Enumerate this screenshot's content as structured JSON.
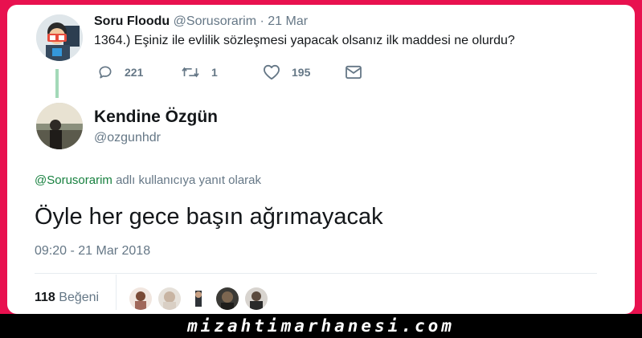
{
  "quoted_tweet": {
    "author_name": "Soru Floodu",
    "author_handle": "@Sorusorarim",
    "separator": "·",
    "date": "21 Mar",
    "text": "1364.) Eşiniz ile evlilik sözleşmesi yapacak olsanız ilk maddesi ne olurdu?",
    "replies": "221",
    "retweets": "1",
    "likes": "195"
  },
  "main_tweet": {
    "author_name": "Kendine Özgün",
    "author_handle": "@ozgunhdr",
    "reply_to_handle": "@Sorusorarim",
    "reply_to_suffix": "adlı kullanıcıya yanıt olarak",
    "text": "Öyle her gece başın ağrımayacak",
    "timestamp": "09:20 - 21 Mar 2018",
    "like_count": "118",
    "like_label": "Beğeni"
  },
  "watermark": "mizahtimarhanesi.com",
  "colors": {
    "frame": "#e8114f",
    "reply_link": "#17803f",
    "thread_line": "#a3d9b8",
    "muted": "#657786"
  },
  "icons": {
    "reply": "reply-icon",
    "retweet": "retweet-icon",
    "like": "heart-icon",
    "dm": "envelope-icon"
  }
}
